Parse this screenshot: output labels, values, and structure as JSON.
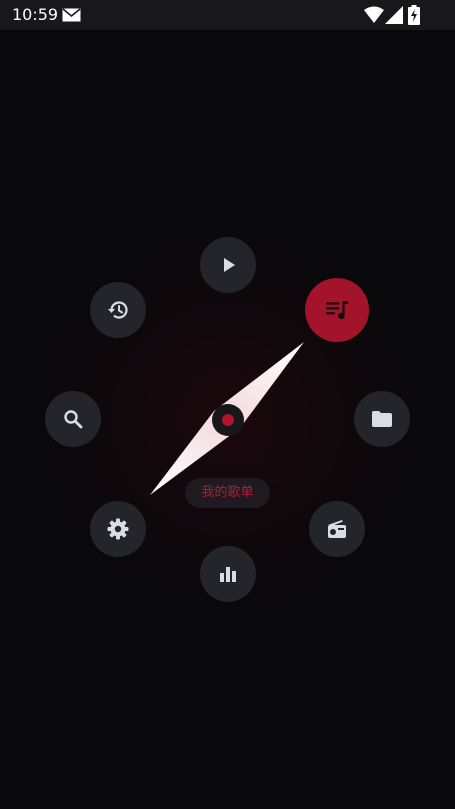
{
  "status_bar": {
    "time": "10:59",
    "icons": [
      "mail-icon",
      "wifi-icon",
      "signal-icon",
      "battery-charging-icon"
    ]
  },
  "radial_menu": {
    "selected_label": "我的歌单",
    "selected_item": "playlist",
    "items": [
      {
        "id": "now-playing",
        "icon": "play-icon"
      },
      {
        "id": "playlist",
        "icon": "playlist-music-icon",
        "active": true
      },
      {
        "id": "folders",
        "icon": "folder-icon"
      },
      {
        "id": "radio",
        "icon": "radio-icon"
      },
      {
        "id": "stats",
        "icon": "bar-chart-icon"
      },
      {
        "id": "settings",
        "icon": "gear-icon"
      },
      {
        "id": "search",
        "icon": "search-icon"
      },
      {
        "id": "history",
        "icon": "history-icon"
      }
    ]
  },
  "colors": {
    "background": "#09090b",
    "status_bar": "#18181c",
    "button": "#24242b",
    "accent": "#a3142a",
    "icon": "#dcdce4",
    "label_text": "#b51a34"
  }
}
